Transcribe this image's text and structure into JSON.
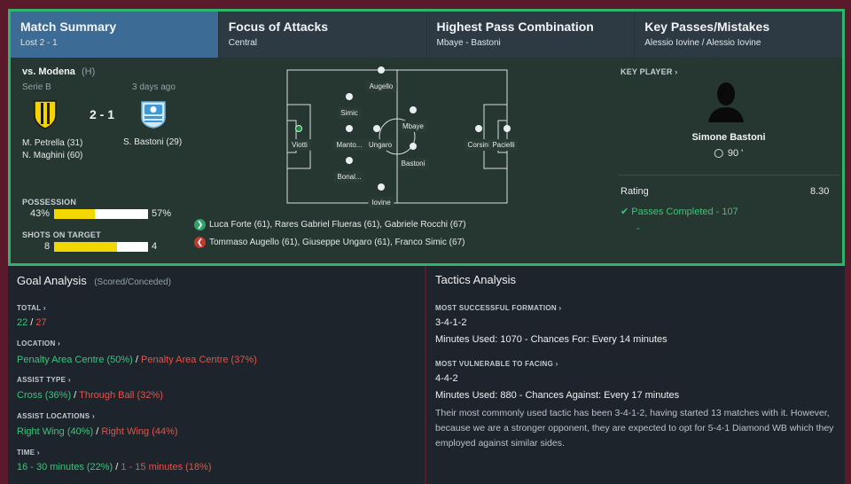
{
  "tabs": [
    {
      "title": "Match Summary",
      "sub": "Lost 2 - 1"
    },
    {
      "title": "Focus of Attacks",
      "sub": "Central"
    },
    {
      "title": "Highest Pass Combination",
      "sub": "Mbaye - Bastoni"
    },
    {
      "title": "Key Passes/Mistakes",
      "sub": "Alessio Iovine / Alessio Iovine"
    }
  ],
  "match": {
    "opponent": "vs. Modena",
    "venue": "(H)",
    "competition": "Serie B",
    "when": "3 days ago",
    "score": "2 - 1",
    "home_scorers": [
      "M. Petrella (31)",
      "N. Maghini (60)"
    ],
    "away_scorers": [
      "S. Bastoni (29)"
    ],
    "possession_label": "POSSESSION",
    "possession": {
      "home": "43%",
      "away": "57%",
      "home_fraction": 0.43
    },
    "shots_label": "SHOTS ON TARGET",
    "shots": {
      "home": "8",
      "away": "4",
      "home_fraction": 0.667
    }
  },
  "players": [
    {
      "name": "Augello"
    },
    {
      "name": "Simic"
    },
    {
      "name": "Mbaye"
    },
    {
      "name": "Viotti"
    },
    {
      "name": "Manto..."
    },
    {
      "name": "Ungaro"
    },
    {
      "name": "Bastoni"
    },
    {
      "name": "Bonal..."
    },
    {
      "name": "Iovine"
    },
    {
      "name": "Corsini"
    },
    {
      "name": "Pacielli"
    }
  ],
  "subs": {
    "on": "Luca Forte (61), Rares Gabriel Flueras (61), Gabriele Rocchi (67)",
    "off": "Tommaso Augello (61), Giuseppe Ungaro (61), Franco Simic (67)"
  },
  "key_player": {
    "label": "KEY PLAYER",
    "name": "Simone Bastoni",
    "minutes": "90 '",
    "rating_label": "Rating",
    "rating": "8.30",
    "stat": "Passes Completed - 107",
    "extra": "-"
  },
  "goal_analysis": {
    "title": "Goal Analysis",
    "subtitle": "(Scored/Conceded)",
    "total_label": "TOTAL",
    "total_scored": "22",
    "total_conceded": "27",
    "location_label": "LOCATION",
    "location_scored": "Penalty Area Centre (50%)",
    "location_conceded": "Penalty Area Centre (37%)",
    "assist_type_label": "ASSIST TYPE",
    "assist_type_scored": "Cross (36%)",
    "assist_type_conceded": "Through Ball (32%)",
    "assist_locations_label": "ASSIST LOCATIONS",
    "assist_locations_scored": "Right Wing (40%)",
    "assist_locations_conceded": "Right Wing (44%)",
    "time_label": "TIME",
    "time_scored": "16 - 30 minutes (22%)",
    "time_conceded": "1 - 15 minutes (18%)"
  },
  "tactics": {
    "title": "Tactics Analysis",
    "success_label": "MOST SUCCESSFUL FORMATION",
    "success_formation": "3-4-1-2",
    "success_detail": "Minutes Used: 1070 - Chances For: Every 14 minutes",
    "vulnerable_label": "MOST VULNERABLE TO FACING",
    "vulnerable_formation": "4-4-2",
    "vulnerable_detail": "Minutes Used: 880 - Chances Against: Every 17 minutes",
    "note": "Their most commonly used tactic has been 3-4-1-2, having started 13 matches with it. However, because we are a stronger opponent, they are expected to opt for 5-4-1 Diamond WB which they employed against similar sides."
  },
  "colors": {
    "accent": "#2fb56b",
    "active_tab": "#3c6c96",
    "possession_bar": "#f0d800",
    "scored": "#3ec47a",
    "conceded": "#e8524a"
  }
}
